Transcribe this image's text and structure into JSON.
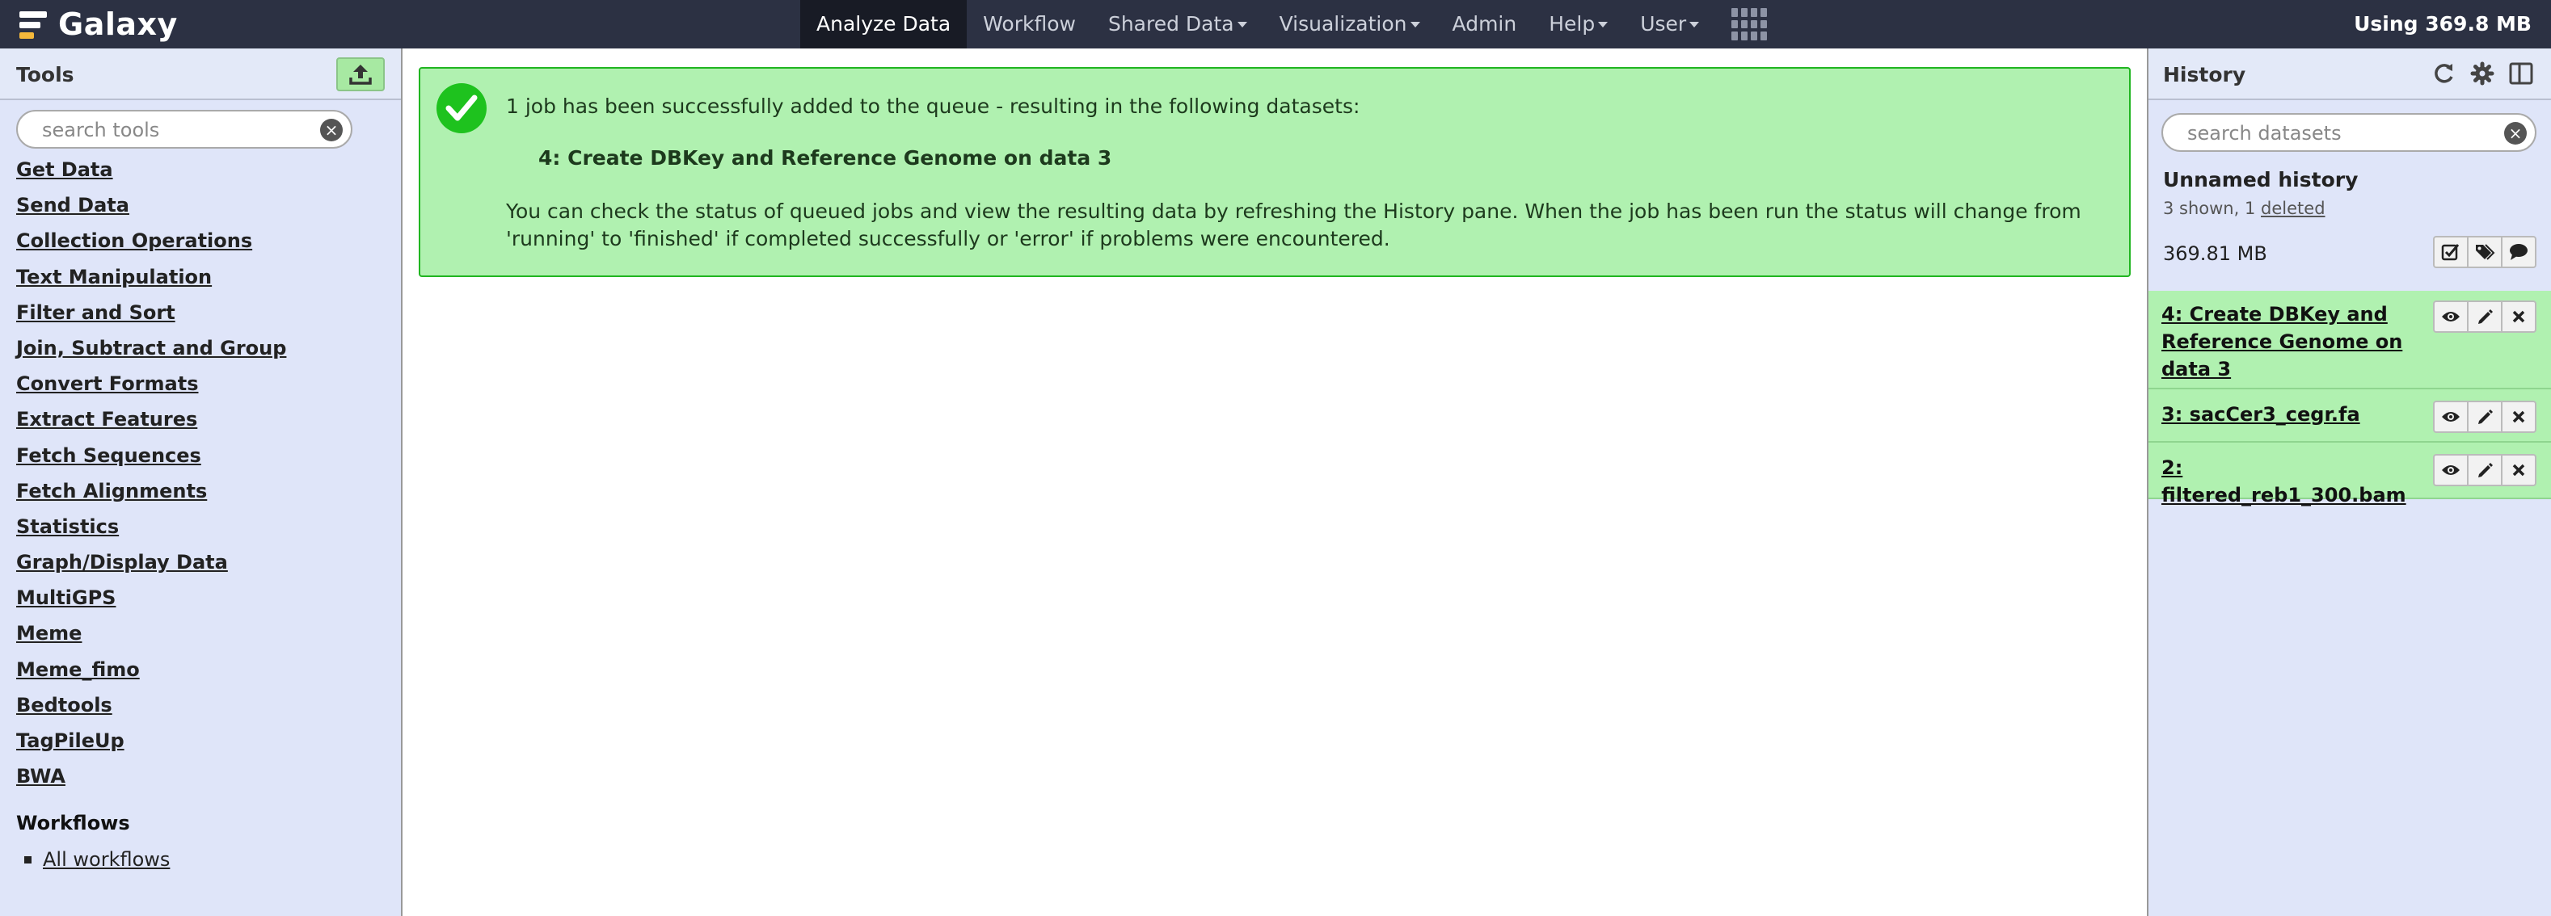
{
  "masthead": {
    "brand": "Galaxy",
    "nav": [
      {
        "label": "Analyze Data",
        "active": true,
        "dropdown": false
      },
      {
        "label": "Workflow",
        "dropdown": false
      },
      {
        "label": "Shared Data",
        "dropdown": true
      },
      {
        "label": "Visualization",
        "dropdown": true
      },
      {
        "label": "Admin",
        "dropdown": false
      },
      {
        "label": "Help",
        "dropdown": true
      },
      {
        "label": "User",
        "dropdown": true
      }
    ],
    "apps_icon": "grid-icon",
    "quota": "Using 369.8 MB"
  },
  "tools": {
    "title": "Tools",
    "upload_icon": "upload-icon",
    "search_placeholder": "search tools",
    "sections": [
      "Get Data",
      "Send Data",
      "Collection Operations",
      "Text Manipulation",
      "Filter and Sort",
      "Join, Subtract and Group",
      "Convert Formats",
      "Extract Features",
      "Fetch Sequences",
      "Fetch Alignments",
      "Statistics",
      "Graph/Display Data",
      "MultiGPS",
      "Meme",
      "Meme_fimo",
      "Bedtools",
      "TagPileUp",
      "BWA"
    ],
    "workflows_heading": "Workflows",
    "workflows_link": "All workflows"
  },
  "message": {
    "icon": "check-circle-icon",
    "line1": "1 job has been successfully added to the queue - resulting in the following datasets:",
    "dataset": "4: Create DBKey and Reference Genome on data 3",
    "body": "You can check the status of queued jobs and view the resulting data by refreshing the History pane. When the job has been run the status will change from 'running' to 'finished' if completed successfully or 'error' if problems were encountered."
  },
  "history": {
    "title": "History",
    "icons": [
      "refresh-icon",
      "gear-icon",
      "columns-icon"
    ],
    "search_placeholder": "search datasets",
    "name": "Unnamed history",
    "shown": "3 shown, 1",
    "deleted": "deleted",
    "size": "369.81 MB",
    "datasets": [
      {
        "title": "4: Create DBKey and Reference Genome on data 3"
      },
      {
        "title": "3: sacCer3_cegr.fa"
      },
      {
        "title": "2: filtered_reb1_300.bam"
      }
    ]
  },
  "colors": {
    "masthead": "#2c3143",
    "panel_bg": "#dfe5f9",
    "success_bg": "#b0f1b0",
    "success_border": "#20b520"
  }
}
